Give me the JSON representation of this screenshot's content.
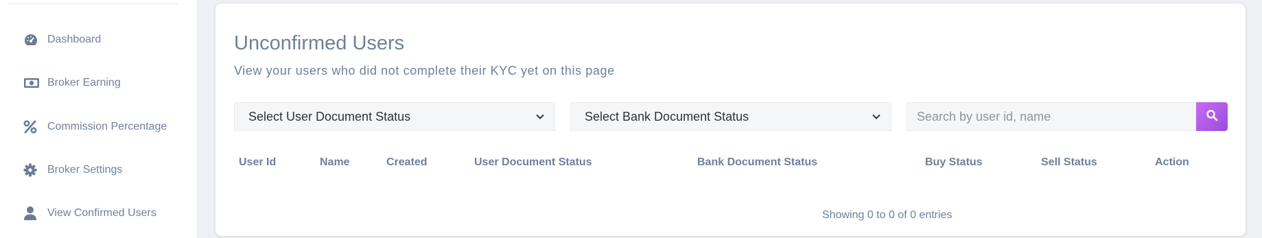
{
  "sidebar": {
    "items": [
      {
        "label": "Dashboard",
        "icon": "dashboard-gauge-icon"
      },
      {
        "label": "Broker Earning",
        "icon": "money-bill-icon"
      },
      {
        "label": "Commission Percentage",
        "icon": "percent-icon"
      },
      {
        "label": "Broker Settings",
        "icon": "gear-icon"
      },
      {
        "label": "View Confirmed Users",
        "icon": "user-icon"
      }
    ]
  },
  "main": {
    "title": "Unconfirmed Users",
    "subtitle": "View your users who did not complete their KYC yet on this page",
    "filters": {
      "user_document_status": "Select User Document Status",
      "bank_document_status": "Select Bank Document Status"
    },
    "search": {
      "placeholder": "Search by user id, name",
      "value": ""
    },
    "table": {
      "headers": [
        "User Id",
        "Name",
        "Created",
        "User Document Status",
        "Bank Document Status",
        "Buy Status",
        "Sell Status",
        "Action"
      ],
      "rows": []
    },
    "pagination_info": "Showing 0 to 0 of 0 entries"
  },
  "colors": {
    "accent_gradient_start": "#c56cf0",
    "accent_gradient_end": "#9b4dde",
    "text_muted": "#6f809a"
  }
}
